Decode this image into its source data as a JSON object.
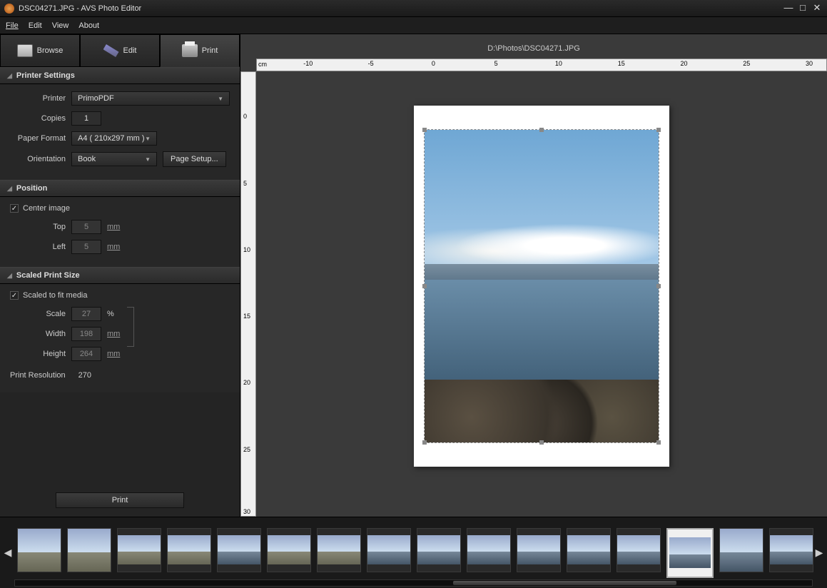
{
  "title": "DSC04271.JPG  -  AVS Photo Editor",
  "menu": {
    "file": "File",
    "edit": "Edit",
    "view": "View",
    "about": "About"
  },
  "tabs": {
    "browse": "Browse",
    "edit": "Edit",
    "print": "Print"
  },
  "filepath": "D:\\Photos\\DSC04271.JPG",
  "ruler_unit": "cm",
  "ruler_h": [
    "-10",
    "-5",
    "0",
    "5",
    "10",
    "15",
    "20",
    "25",
    "30"
  ],
  "ruler_v": [
    "0",
    "5",
    "10",
    "15",
    "20",
    "25",
    "30"
  ],
  "printer_settings": {
    "header": "Printer Settings",
    "printer_label": "Printer",
    "printer_value": "PrimoPDF",
    "copies_label": "Copies",
    "copies_value": "1",
    "paper_label": "Paper Format",
    "paper_value": "A4 ( 210x297 mm )",
    "orientation_label": "Orientation",
    "orientation_value": "Book",
    "page_setup": "Page Setup..."
  },
  "position": {
    "header": "Position",
    "center": "Center image",
    "top_label": "Top",
    "top_value": "5",
    "left_label": "Left",
    "left_value": "5",
    "unit": "mm"
  },
  "scaled": {
    "header": "Scaled Print Size",
    "fit": "Scaled to fit media",
    "scale_label": "Scale",
    "scale_value": "27",
    "scale_unit": "%",
    "width_label": "Width",
    "width_value": "198",
    "height_label": "Height",
    "height_value": "264",
    "unit": "mm",
    "res_label": "Print Resolution",
    "res_value": "270"
  },
  "print_button": "Print"
}
